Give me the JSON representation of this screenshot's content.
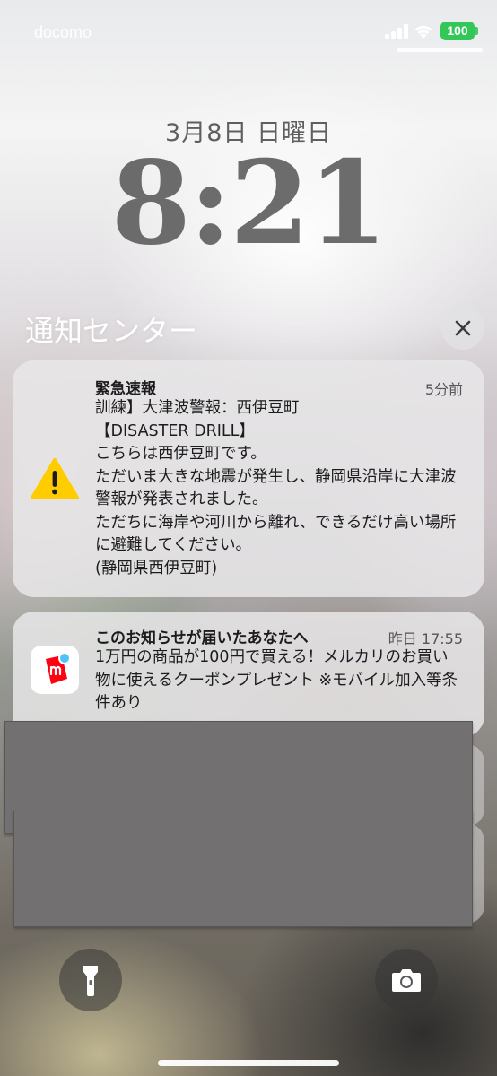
{
  "status_bar": {
    "carrier": "docomo",
    "battery": "100",
    "battery_color": "#33c759"
  },
  "lock_screen": {
    "date": "3月8日 日曜日",
    "time": "8:21"
  },
  "notification_center": {
    "title": "通知センター",
    "close_icon": "close-icon"
  },
  "notifications": [
    {
      "app_icon": "warning-icon",
      "title": "緊急速報",
      "time": "5分前",
      "body": "訓練】大津波警報：西伊豆町\n【DISASTER DRILL】\nこちらは西伊豆町です。\nただいま大きな地震が発生し、静岡県沿岸に大津波警報が発表されました。\nただちに海岸や河川から離れ、できるだけ高い場所に避難してください。\n(静岡県西伊豆町)"
    },
    {
      "app_icon": "mercari-icon",
      "title": "このお知らせが届いたあなたへ",
      "time": "昨日 17:55",
      "body": "1万円の商品が100円で買える！メルカリのお買い物に使えるクーポンプレゼント ※モバイル加入等条件あり",
      "accent": "#ff0211"
    }
  ],
  "bottom_controls": {
    "left": "flashlight-icon",
    "right": "camera-icon"
  }
}
